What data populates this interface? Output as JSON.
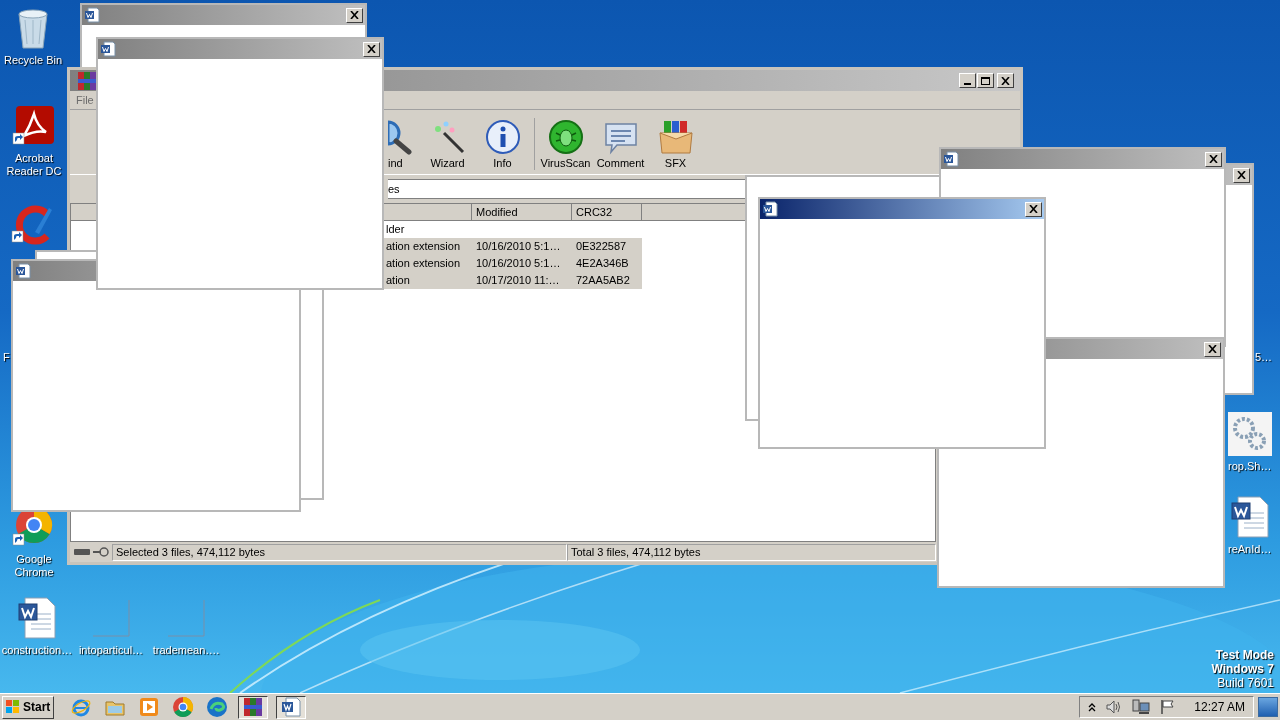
{
  "desktop": {
    "icons": [
      {
        "kind": "recycle",
        "label": "Recycle Bin"
      },
      {
        "kind": "acrobat",
        "label": "Acrobat Reader DC"
      },
      {
        "kind": "ccleaner"
      },
      {
        "kind": "label_only",
        "label": "F"
      },
      {
        "kind": "chrome",
        "label": "Google Chrome"
      },
      {
        "kind": "word",
        "label": "construction…"
      },
      {
        "kind": "blank",
        "label": "intoparticul…"
      },
      {
        "kind": "blank",
        "label": "trademean…."
      },
      {
        "kind": "label_only",
        "label": "5…"
      },
      {
        "kind": "gear",
        "label": "rop.Sh…"
      },
      {
        "kind": "word",
        "label": "reAnId…"
      }
    ],
    "system_notice": [
      {
        "text": "Test Mode",
        "bold": true
      },
      {
        "text": "Windows 7",
        "bold": true
      },
      {
        "text": "Build 7601",
        "bold": false
      }
    ]
  },
  "archiver": {
    "active": false,
    "menu": [
      "File"
    ],
    "toolbar": [
      {
        "kind": "find",
        "label": "ind"
      },
      {
        "kind": "wizard",
        "label": "Wizard"
      },
      {
        "kind": "info",
        "label": "Info"
      },
      {
        "kind": "separator"
      },
      {
        "kind": "virusscan",
        "label": "VirusScan"
      },
      {
        "kind": "comment",
        "label": "Comment"
      },
      {
        "kind": "sfx",
        "label": "SFX"
      }
    ],
    "address": "es",
    "columns": [
      "Modified",
      "CRC32"
    ],
    "rows": [
      {
        "column_1": "lder",
        "selected": false
      },
      {
        "column_1": "ation extension",
        "modified": "10/16/2010 5:1…",
        "crc32": "0E322587",
        "selected": true
      },
      {
        "column_1": "ation extension",
        "modified": "10/16/2010 5:1…",
        "crc32": "4E2A346B",
        "selected": true
      },
      {
        "column_1": "ation",
        "modified": "10/17/2010 11:…",
        "crc32": "72AA5AB2",
        "selected": true
      }
    ],
    "status": [
      "Selected 3 files, 474,112 bytes",
      "Total 3 files, 474,112 bytes"
    ]
  },
  "windows": [
    {
      "kind": "document",
      "active": false,
      "behind_archiver": true
    },
    {
      "kind": "frame"
    },
    {
      "kind": "document",
      "active": false
    },
    {
      "kind": "document",
      "active": false
    },
    {
      "kind": "document",
      "active": false
    },
    {
      "kind": "document",
      "active": true
    },
    {
      "kind": "frame"
    },
    {
      "kind": "document",
      "active": false
    },
    {
      "kind": "document",
      "active": false
    }
  ],
  "taskbar": {
    "start": "Start",
    "apps": [
      {
        "kind": "ie",
        "pressed": false
      },
      {
        "kind": "explorer",
        "pressed": false
      },
      {
        "kind": "media",
        "pressed": false
      },
      {
        "kind": "chrome",
        "pressed": false
      },
      {
        "kind": "edge",
        "pressed": false
      },
      {
        "kind": "archiver",
        "pressed": true
      },
      {
        "kind": "word",
        "pressed": true
      }
    ],
    "clock": "12:27 AM"
  }
}
